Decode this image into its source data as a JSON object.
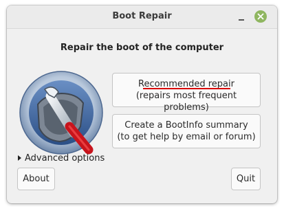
{
  "window": {
    "title": "Boot Repair"
  },
  "main": {
    "headline": "Repair the boot of the computer",
    "recommended": {
      "line1": "Recommended repair",
      "line2": "(repairs most frequent problems)"
    },
    "bootinfo": {
      "line1": "Create a BootInfo summary",
      "line2": "(to get help by email or forum)"
    },
    "advanced_label": "Advanced options"
  },
  "footer": {
    "about_label": "About",
    "quit_label": "Quit"
  },
  "colors": {
    "titlebar_bg": "#ebebeb",
    "close_button": "#8fb660",
    "annotation_underline": "#d80000",
    "window_bg": "#f0f0f0"
  },
  "icons": {
    "logo": "boot-repair-logo-icon",
    "minimize": "minimize-icon",
    "close": "close-icon",
    "expander": "triangle-right-icon"
  }
}
